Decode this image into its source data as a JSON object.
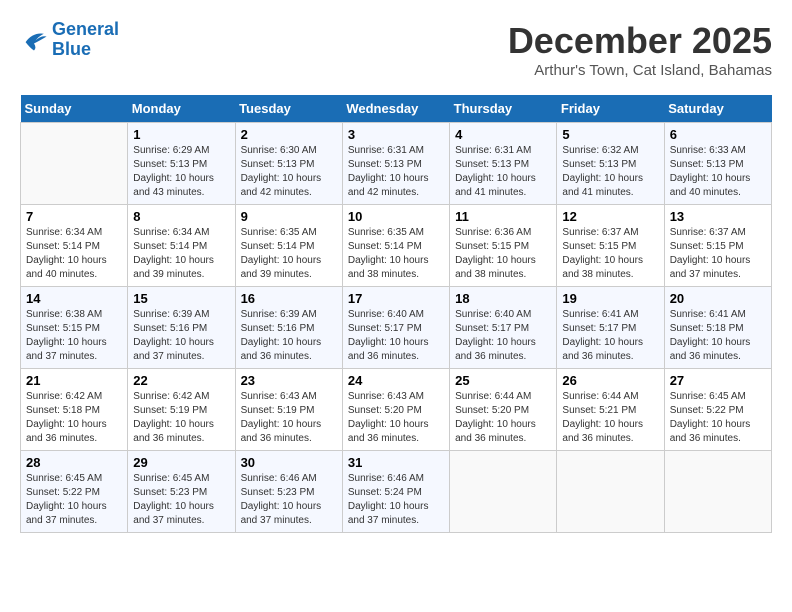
{
  "logo": {
    "line1": "General",
    "line2": "Blue"
  },
  "title": "December 2025",
  "location": "Arthur's Town, Cat Island, Bahamas",
  "weekdays": [
    "Sunday",
    "Monday",
    "Tuesday",
    "Wednesday",
    "Thursday",
    "Friday",
    "Saturday"
  ],
  "weeks": [
    [
      {
        "day": "",
        "sunrise": "",
        "sunset": "",
        "daylight": ""
      },
      {
        "day": "1",
        "sunrise": "Sunrise: 6:29 AM",
        "sunset": "Sunset: 5:13 PM",
        "daylight": "Daylight: 10 hours and 43 minutes."
      },
      {
        "day": "2",
        "sunrise": "Sunrise: 6:30 AM",
        "sunset": "Sunset: 5:13 PM",
        "daylight": "Daylight: 10 hours and 42 minutes."
      },
      {
        "day": "3",
        "sunrise": "Sunrise: 6:31 AM",
        "sunset": "Sunset: 5:13 PM",
        "daylight": "Daylight: 10 hours and 42 minutes."
      },
      {
        "day": "4",
        "sunrise": "Sunrise: 6:31 AM",
        "sunset": "Sunset: 5:13 PM",
        "daylight": "Daylight: 10 hours and 41 minutes."
      },
      {
        "day": "5",
        "sunrise": "Sunrise: 6:32 AM",
        "sunset": "Sunset: 5:13 PM",
        "daylight": "Daylight: 10 hours and 41 minutes."
      },
      {
        "day": "6",
        "sunrise": "Sunrise: 6:33 AM",
        "sunset": "Sunset: 5:13 PM",
        "daylight": "Daylight: 10 hours and 40 minutes."
      }
    ],
    [
      {
        "day": "7",
        "sunrise": "Sunrise: 6:34 AM",
        "sunset": "Sunset: 5:14 PM",
        "daylight": "Daylight: 10 hours and 40 minutes."
      },
      {
        "day": "8",
        "sunrise": "Sunrise: 6:34 AM",
        "sunset": "Sunset: 5:14 PM",
        "daylight": "Daylight: 10 hours and 39 minutes."
      },
      {
        "day": "9",
        "sunrise": "Sunrise: 6:35 AM",
        "sunset": "Sunset: 5:14 PM",
        "daylight": "Daylight: 10 hours and 39 minutes."
      },
      {
        "day": "10",
        "sunrise": "Sunrise: 6:35 AM",
        "sunset": "Sunset: 5:14 PM",
        "daylight": "Daylight: 10 hours and 38 minutes."
      },
      {
        "day": "11",
        "sunrise": "Sunrise: 6:36 AM",
        "sunset": "Sunset: 5:15 PM",
        "daylight": "Daylight: 10 hours and 38 minutes."
      },
      {
        "day": "12",
        "sunrise": "Sunrise: 6:37 AM",
        "sunset": "Sunset: 5:15 PM",
        "daylight": "Daylight: 10 hours and 38 minutes."
      },
      {
        "day": "13",
        "sunrise": "Sunrise: 6:37 AM",
        "sunset": "Sunset: 5:15 PM",
        "daylight": "Daylight: 10 hours and 37 minutes."
      }
    ],
    [
      {
        "day": "14",
        "sunrise": "Sunrise: 6:38 AM",
        "sunset": "Sunset: 5:15 PM",
        "daylight": "Daylight: 10 hours and 37 minutes."
      },
      {
        "day": "15",
        "sunrise": "Sunrise: 6:39 AM",
        "sunset": "Sunset: 5:16 PM",
        "daylight": "Daylight: 10 hours and 37 minutes."
      },
      {
        "day": "16",
        "sunrise": "Sunrise: 6:39 AM",
        "sunset": "Sunset: 5:16 PM",
        "daylight": "Daylight: 10 hours and 36 minutes."
      },
      {
        "day": "17",
        "sunrise": "Sunrise: 6:40 AM",
        "sunset": "Sunset: 5:17 PM",
        "daylight": "Daylight: 10 hours and 36 minutes."
      },
      {
        "day": "18",
        "sunrise": "Sunrise: 6:40 AM",
        "sunset": "Sunset: 5:17 PM",
        "daylight": "Daylight: 10 hours and 36 minutes."
      },
      {
        "day": "19",
        "sunrise": "Sunrise: 6:41 AM",
        "sunset": "Sunset: 5:17 PM",
        "daylight": "Daylight: 10 hours and 36 minutes."
      },
      {
        "day": "20",
        "sunrise": "Sunrise: 6:41 AM",
        "sunset": "Sunset: 5:18 PM",
        "daylight": "Daylight: 10 hours and 36 minutes."
      }
    ],
    [
      {
        "day": "21",
        "sunrise": "Sunrise: 6:42 AM",
        "sunset": "Sunset: 5:18 PM",
        "daylight": "Daylight: 10 hours and 36 minutes."
      },
      {
        "day": "22",
        "sunrise": "Sunrise: 6:42 AM",
        "sunset": "Sunset: 5:19 PM",
        "daylight": "Daylight: 10 hours and 36 minutes."
      },
      {
        "day": "23",
        "sunrise": "Sunrise: 6:43 AM",
        "sunset": "Sunset: 5:19 PM",
        "daylight": "Daylight: 10 hours and 36 minutes."
      },
      {
        "day": "24",
        "sunrise": "Sunrise: 6:43 AM",
        "sunset": "Sunset: 5:20 PM",
        "daylight": "Daylight: 10 hours and 36 minutes."
      },
      {
        "day": "25",
        "sunrise": "Sunrise: 6:44 AM",
        "sunset": "Sunset: 5:20 PM",
        "daylight": "Daylight: 10 hours and 36 minutes."
      },
      {
        "day": "26",
        "sunrise": "Sunrise: 6:44 AM",
        "sunset": "Sunset: 5:21 PM",
        "daylight": "Daylight: 10 hours and 36 minutes."
      },
      {
        "day": "27",
        "sunrise": "Sunrise: 6:45 AM",
        "sunset": "Sunset: 5:22 PM",
        "daylight": "Daylight: 10 hours and 36 minutes."
      }
    ],
    [
      {
        "day": "28",
        "sunrise": "Sunrise: 6:45 AM",
        "sunset": "Sunset: 5:22 PM",
        "daylight": "Daylight: 10 hours and 37 minutes."
      },
      {
        "day": "29",
        "sunrise": "Sunrise: 6:45 AM",
        "sunset": "Sunset: 5:23 PM",
        "daylight": "Daylight: 10 hours and 37 minutes."
      },
      {
        "day": "30",
        "sunrise": "Sunrise: 6:46 AM",
        "sunset": "Sunset: 5:23 PM",
        "daylight": "Daylight: 10 hours and 37 minutes."
      },
      {
        "day": "31",
        "sunrise": "Sunrise: 6:46 AM",
        "sunset": "Sunset: 5:24 PM",
        "daylight": "Daylight: 10 hours and 37 minutes."
      },
      {
        "day": "",
        "sunrise": "",
        "sunset": "",
        "daylight": ""
      },
      {
        "day": "",
        "sunrise": "",
        "sunset": "",
        "daylight": ""
      },
      {
        "day": "",
        "sunrise": "",
        "sunset": "",
        "daylight": ""
      }
    ]
  ]
}
